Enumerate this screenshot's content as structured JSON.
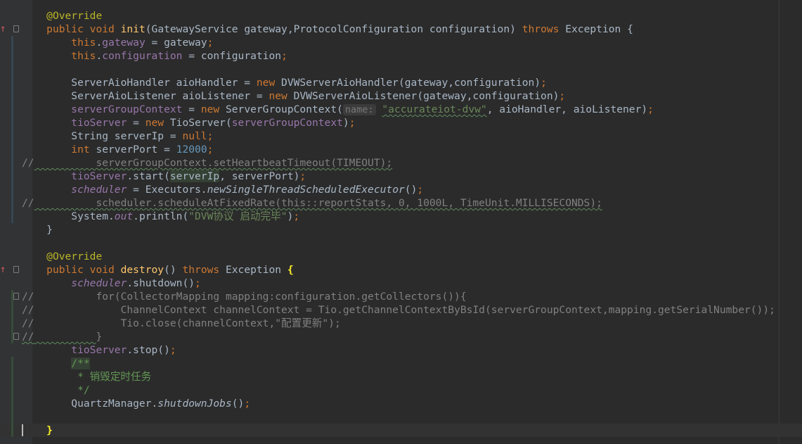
{
  "editor": {
    "lines": [
      [
        [
          "    ",
          ""
        ],
        [
          "@Override",
          "ann"
        ]
      ],
      [
        [
          "    ",
          ""
        ],
        [
          "public void ",
          "kw"
        ],
        [
          "init",
          "fn"
        ],
        [
          "(GatewayService gateway,ProtocolConfiguration configuration) ",
          ""
        ],
        [
          "throws ",
          "kw"
        ],
        [
          "Exception {",
          ""
        ]
      ],
      [
        [
          "        ",
          ""
        ],
        [
          "this",
          "kw"
        ],
        [
          ".",
          ""
        ],
        [
          "gateway",
          "fld"
        ],
        [
          " = gateway",
          ""
        ],
        [
          ";",
          "kw"
        ]
      ],
      [
        [
          "        ",
          ""
        ],
        [
          "this",
          "kw"
        ],
        [
          ".",
          ""
        ],
        [
          "configuration",
          "fld"
        ],
        [
          " = configuration",
          ""
        ],
        [
          ";",
          "kw"
        ]
      ],
      [],
      [
        [
          "        ServerAioHandler aioHandler = ",
          ""
        ],
        [
          "new ",
          "kw"
        ],
        [
          "DVWServerAioHandler(gateway,configuration)",
          ""
        ],
        [
          ";",
          "kw"
        ]
      ],
      [
        [
          "        ServerAioListener aioListener = ",
          ""
        ],
        [
          "new ",
          "kw"
        ],
        [
          "DVWServerAioListener(gateway,configuration)",
          ""
        ],
        [
          ";",
          "kw"
        ]
      ],
      [
        [
          "        ",
          ""
        ],
        [
          "serverGroupContext",
          "fld"
        ],
        [
          " = ",
          ""
        ],
        [
          "new ",
          "kw"
        ],
        [
          "ServerGroupContext(",
          ""
        ],
        [
          "name:",
          "hint"
        ],
        [
          " ",
          ""
        ],
        [
          "\"accurateiot-dvw\"",
          "str sqg"
        ],
        [
          ", aioHandler, aioListener)",
          ""
        ],
        [
          ";",
          "kw"
        ]
      ],
      [
        [
          "        ",
          ""
        ],
        [
          "tioServer",
          "fld"
        ],
        [
          " = ",
          ""
        ],
        [
          "new ",
          "kw"
        ],
        [
          "TioServer(",
          ""
        ],
        [
          "serverGroupContext",
          "fld"
        ],
        [
          ")",
          ""
        ],
        [
          ";",
          "kw"
        ]
      ],
      [
        [
          "        String serverIp = ",
          ""
        ],
        [
          "null",
          "kw"
        ],
        [
          ";",
          "kw"
        ]
      ],
      [
        [
          "        ",
          ""
        ],
        [
          "int ",
          "kw"
        ],
        [
          "serverPort = ",
          ""
        ],
        [
          "12000",
          "num"
        ],
        [
          ";",
          "kw"
        ]
      ],
      [
        [
          "//",
          "cmt"
        ],
        [
          "          serverGroupContext.setHeartbeatTimeout(TIMEOUT);",
          "cmt sqg"
        ]
      ],
      [
        [
          "        ",
          ""
        ],
        [
          "tioServer",
          "fld"
        ],
        [
          ".start(",
          ""
        ],
        [
          "serverIp",
          "hl"
        ],
        [
          ", serverPort)",
          ""
        ],
        [
          ";",
          "kw"
        ]
      ],
      [
        [
          "        ",
          ""
        ],
        [
          "scheduler",
          "fld it"
        ],
        [
          " = Executors.",
          ""
        ],
        [
          "newSingleThreadScheduledExecutor",
          "it"
        ],
        [
          "()",
          ""
        ],
        [
          ";",
          "kw"
        ]
      ],
      [
        [
          "//",
          "cmt"
        ],
        [
          "          scheduler.scheduleAtFixedRate(this::reportStats, 0, 1000L, TimeUnit.MILLISECONDS);",
          "cmt sqg"
        ]
      ],
      [
        [
          "        System.",
          ""
        ],
        [
          "out",
          "fld it"
        ],
        [
          ".println(",
          ""
        ],
        [
          "\"DVW协议 启动完毕\"",
          "str"
        ],
        [
          ")",
          ""
        ],
        [
          ";",
          "kw"
        ]
      ],
      [
        [
          "    }",
          ""
        ]
      ],
      [],
      [
        [
          "    ",
          ""
        ],
        [
          "@Override",
          "ann"
        ]
      ],
      [
        [
          "    ",
          ""
        ],
        [
          "public void ",
          "kw"
        ],
        [
          "destroy",
          "fn"
        ],
        [
          "() ",
          ""
        ],
        [
          "throws ",
          "kw"
        ],
        [
          "Exception ",
          ""
        ],
        [
          "{",
          "brace"
        ]
      ],
      [
        [
          "        ",
          ""
        ],
        [
          "scheduler",
          "fld it"
        ],
        [
          ".shutdown()",
          ""
        ],
        [
          ";",
          "kw"
        ]
      ],
      [
        [
          "//",
          "cmt"
        ],
        [
          "          for(CollectorMapping mapping:configuration.getCollectors()){",
          "cmt"
        ]
      ],
      [
        [
          "//",
          "cmt"
        ],
        [
          "              ChannelContext channelContext = Tio.getChannelContextByBsId(serverGroupContext,mapping.getSerialNumber());",
          "cmt"
        ]
      ],
      [
        [
          "//",
          "cmt"
        ],
        [
          "              Tio.close(channelContext,\"配置更新\");",
          "cmt"
        ]
      ],
      [
        [
          "//",
          "cmt sqg"
        ],
        [
          "          ",
          "cmt sqg"
        ],
        [
          "}",
          "cmt"
        ]
      ],
      [
        [
          "        ",
          ""
        ],
        [
          "tioServer",
          "fld"
        ],
        [
          ".stop()",
          ""
        ],
        [
          ";",
          "kw"
        ]
      ],
      [
        [
          "        ",
          ""
        ],
        [
          "/**",
          "doc docbg"
        ]
      ],
      [
        [
          "         * 销毁定时任务",
          "doc"
        ]
      ],
      [
        [
          "         */",
          "doc"
        ]
      ],
      [
        [
          "        QuartzManager.",
          ""
        ],
        [
          "shutdownJobs",
          "it"
        ],
        [
          "()",
          ""
        ],
        [
          ";",
          "kw"
        ]
      ],
      [],
      [
        [
          "    ",
          ""
        ],
        [
          "}",
          "brace"
        ]
      ]
    ],
    "gutter": {
      "override_arrow": "↑"
    }
  },
  "colors": {
    "background": "#2b2b2b",
    "gutter": "#313335",
    "keyword": "#cc7832",
    "annotation": "#bbb529",
    "field": "#9876aa",
    "method": "#ffc66d",
    "string": "#6a8759",
    "number": "#6897bb",
    "comment": "#808080"
  }
}
